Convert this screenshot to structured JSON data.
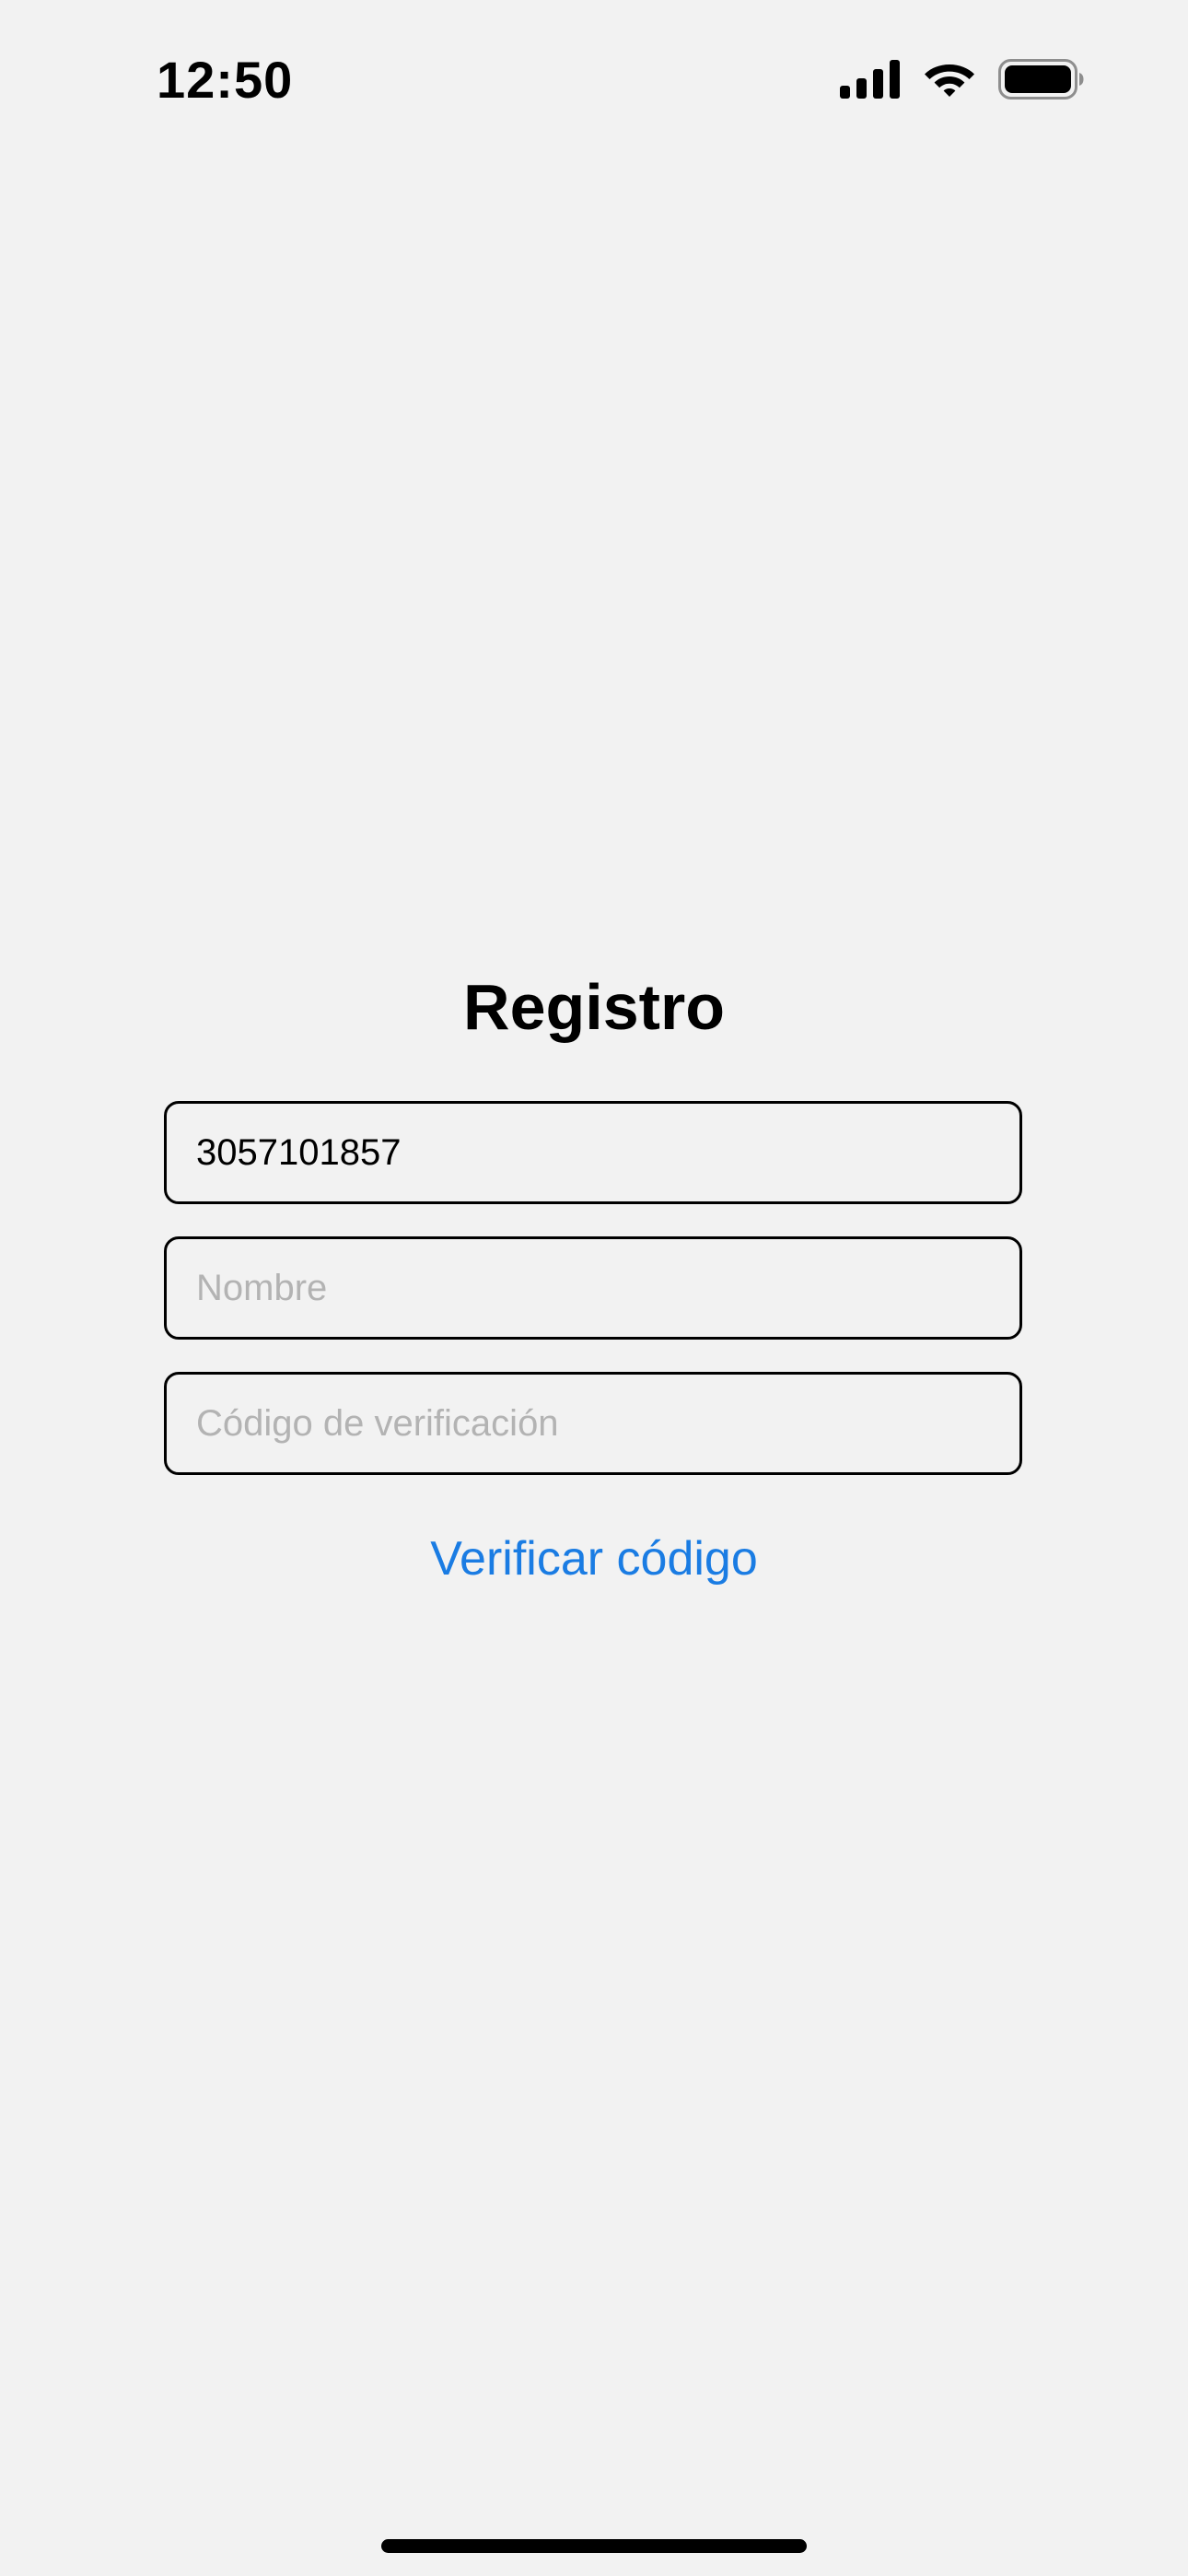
{
  "status_bar": {
    "time": "12:50",
    "icons": [
      "cellular-signal-icon",
      "wifi-icon",
      "battery-icon"
    ]
  },
  "screen": {
    "title": "Registro",
    "fields": {
      "phone": {
        "value": "3057101857",
        "placeholder": ""
      },
      "name": {
        "value": "",
        "placeholder": "Nombre"
      },
      "code": {
        "value": "",
        "placeholder": "Código de verificación"
      }
    },
    "verify_button_label": "Verificar código"
  },
  "colors": {
    "background": "#f2f2f2",
    "accent": "#1a7ce3",
    "placeholder": "#b3b3b3",
    "text": "#000000"
  }
}
